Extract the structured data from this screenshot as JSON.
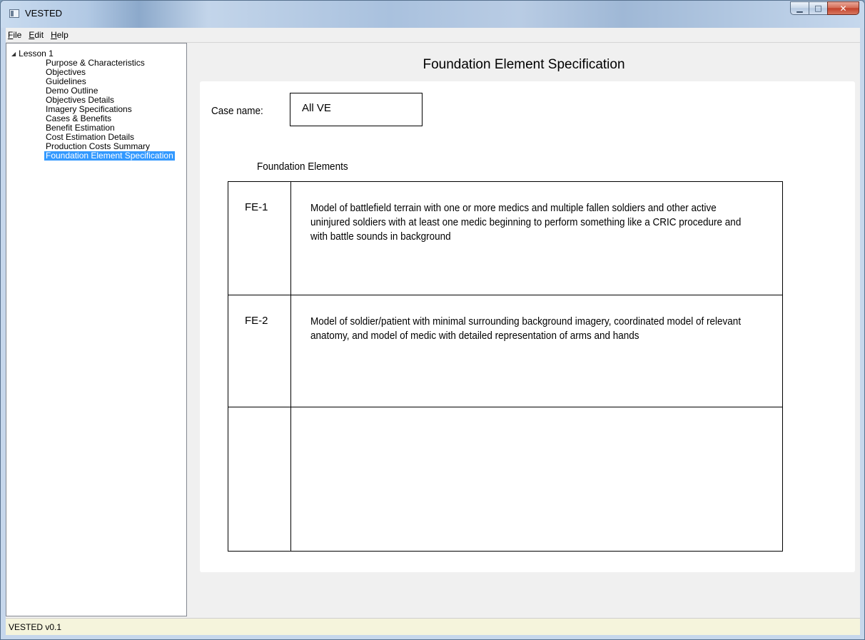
{
  "window": {
    "title": "VESTED",
    "minimize_glyph": "▁",
    "maximize_glyph": "□",
    "close_glyph": "✕"
  },
  "menu": {
    "items": [
      {
        "accel": "F",
        "rest": "ile"
      },
      {
        "accel": "E",
        "rest": "dit"
      },
      {
        "accel": "H",
        "rest": "elp"
      }
    ]
  },
  "tree": {
    "root_label": "Lesson 1",
    "items": [
      "Purpose & Characteristics",
      "Objectives",
      "Guidelines",
      "Demo Outline",
      "Objectives Details",
      "Imagery Specifications",
      "Cases & Benefits",
      "Benefit Estimation",
      "Cost Estimation Details",
      "Production Costs Summary",
      "Foundation Element Specification"
    ],
    "selected_index": 10
  },
  "page": {
    "title": "Foundation Element Specification",
    "case_label": "Case name:",
    "case_value": "All VE",
    "fe_heading": "Foundation Elements",
    "elements": [
      {
        "id": "FE-1",
        "description": "Model of battlefield terrain with one or more medics and multiple fallen soldiers and other active uninjured soldiers with at least one medic beginning to perform something like a CRIC procedure and with battle sounds in background"
      },
      {
        "id": "FE-2",
        "description": "Model of soldier/patient with minimal surrounding background imagery, coordinated model of relevant anatomy, and model of medic with detailed representation of arms and hands"
      },
      {
        "id": "",
        "description": ""
      }
    ]
  },
  "status": {
    "text": "VESTED v0.1"
  },
  "colors": {
    "selection": "#3399ff",
    "status_bg": "#f5f4dc",
    "close_button": "#c2402a"
  }
}
